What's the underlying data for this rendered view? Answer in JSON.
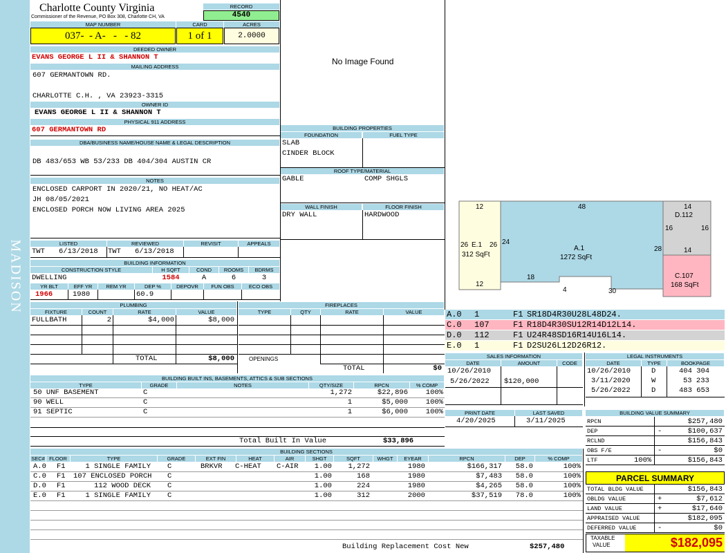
{
  "side_label": "MADISON",
  "county": {
    "name": "Charlotte County Virginia",
    "sub": "Commissioner of the Revenue, PO Box 308, Charlotte CH, VA"
  },
  "record": {
    "label": "RECORD",
    "value": "4540"
  },
  "map": {
    "label": "MAP NUMBER",
    "value": "037-  - A-   -   - 82"
  },
  "card": {
    "label": "CARD",
    "value": "1 of 1"
  },
  "acres": {
    "label": "ACRES",
    "value": "2.0000"
  },
  "owner": {
    "label": "DEEDED OWNER",
    "value": "EVANS GEORGE L II & SHANNON T"
  },
  "mailing": {
    "label": "MAILING ADDRESS",
    "line1": "607 GERMANTOWN RD.",
    "line2": "CHARLOTTE C.H. , VA 23923-3315"
  },
  "owner_id": {
    "label": "OWNER ID",
    "value": "EVANS GEORGE L II & SHANNON T"
  },
  "physical": {
    "label": "PHYSICAL 911 ADDRESS",
    "value": "607 GERMANTOWN RD"
  },
  "legal_desc": {
    "label": "DBA/BUSINESS NAME/HOUSE NAME & LEGAL DESCRIPTION",
    "value": "DB 483/653 WB 53/233 DB 404/304 AUSTIN CR"
  },
  "notes": {
    "label": "NOTES",
    "lines": [
      "ENCLOSED CARPORT IN 2020/21, NO HEAT/AC",
      "JH 08/05/2021",
      "ENCLOSED PORCH NOW LIVING AREA 2025"
    ]
  },
  "listed": {
    "label": "LISTED",
    "by": "TWT",
    "date": "6/13/2018"
  },
  "reviewed": {
    "label": "REVIEWED",
    "by": "TWT",
    "date": "6/13/2018"
  },
  "revisit": {
    "label": "REVISIT"
  },
  "appeals": {
    "label": "APPEALS"
  },
  "image_placeholder": "No Image Found",
  "building_props": {
    "label": "BUILDING PROPERTIES",
    "foundation_label": "FOUNDATION",
    "fuel_label": "FUEL TYPE",
    "foundation": [
      "SLAB",
      "CINDER BLOCK"
    ],
    "roof_label": "ROOF TYPE/MATERIAL",
    "roof_type": "GABLE",
    "roof_material": "COMP SHGLS",
    "wall_label": "WALL FINISH",
    "floor_label": "FLOOR FINISH",
    "wall": "DRY WALL",
    "floor": "HARDWOOD"
  },
  "building_info": {
    "label": "BUILDING INFORMATION",
    "h_style": "CONSTRUCTION STYLE",
    "h_hsqft": "H SQFT",
    "h_cond": "COND",
    "h_rooms": "ROOMS",
    "h_bdrms": "BDRMS",
    "style": "DWELLING",
    "hsqft": "1584",
    "cond": "A",
    "rooms": "6",
    "bdrms": "3",
    "h_yrblt": "YR BLT",
    "h_effyr": "EFF YR",
    "h_remyr": "REM YR",
    "h_dep": "DEP %",
    "h_depovr": "DEPOVR",
    "h_funobs": "FUN OBS",
    "h_ecoobs": "ECO OBS",
    "yrblt": "1966",
    "effyr": "1980",
    "dep": "60.9"
  },
  "plumbing": {
    "label": "PLUMBING",
    "headers": [
      "FIXTURE",
      "COUNT",
      "RATE",
      "VALUE"
    ],
    "rows": [
      {
        "fixture": "FULLBATH",
        "count": "2",
        "rate": "$4,000",
        "value": "$8,000"
      }
    ],
    "total_label": "TOTAL",
    "total": "$8,000"
  },
  "fireplaces": {
    "label": "FIREPLACES",
    "headers": [
      "TYPE",
      "QTY",
      "RATE",
      "VALUE"
    ],
    "openings_label": "OPENINGS",
    "total_label": "TOTAL",
    "total": "$0"
  },
  "builtins": {
    "label": "BUILDING BUILT INS, BASEMENTS, ATTICS & SUB SECTIONS",
    "headers": [
      "TYPE",
      "GRADE",
      "NOTES",
      "QTY/SIZE",
      "RPCN",
      "% COMP"
    ],
    "rows": [
      {
        "type": "50 UNF BASEMENT",
        "grade": "C",
        "qty": "1,272",
        "rpcn": "$22,896",
        "comp": "100%"
      },
      {
        "type": "90 WELL",
        "grade": "C",
        "qty": "1",
        "rpcn": "$5,000",
        "comp": "100%"
      },
      {
        "type": "91 SEPTIC",
        "grade": "C",
        "qty": "1",
        "rpcn": "$6,000",
        "comp": "100%"
      }
    ],
    "total_label": "Total Built In Value",
    "total": "$33,896"
  },
  "sections": {
    "label": "BUILDING SECTIONS",
    "headers": [
      "SEC#",
      "FLOOR",
      "TYPE",
      "GRADE",
      "EXT FIN",
      "HEAT",
      "AIR",
      "SHGT",
      "SQFT",
      "WHGT",
      "EYEAR",
      "RPCN",
      "DEP",
      "% COMP"
    ],
    "rows": [
      {
        "sec": "A.0",
        "floor": "F1",
        "type": "1 SINGLE FAMILY",
        "grade": "C",
        "extfin": "BRKVR",
        "heat": "C-HEAT",
        "air": "C-AIR",
        "shgt": "1.00",
        "sqft": "1,272",
        "eyear": "1980",
        "rpcn": "$166,317",
        "dep": "58.0",
        "comp": "100%"
      },
      {
        "sec": "C.0",
        "floor": "F1",
        "type": "107 ENCLOSED PORCH",
        "grade": "C",
        "extfin": "",
        "heat": "",
        "air": "",
        "shgt": "1.00",
        "sqft": "168",
        "eyear": "1980",
        "rpcn": "$7,483",
        "dep": "58.0",
        "comp": "100%"
      },
      {
        "sec": "D.0",
        "floor": "F1",
        "type": "112 WOOD DECK",
        "grade": "C",
        "extfin": "",
        "heat": "",
        "air": "",
        "shgt": "1.00",
        "sqft": "224",
        "eyear": "1980",
        "rpcn": "$4,265",
        "dep": "58.0",
        "comp": "100%"
      },
      {
        "sec": "E.0",
        "floor": "F1",
        "type": "1 SINGLE FAMILY",
        "grade": "C",
        "extfin": "",
        "heat": "",
        "air": "",
        "shgt": "1.00",
        "sqft": "312",
        "eyear": "2000",
        "rpcn": "$37,519",
        "dep": "78.0",
        "comp": "100%"
      }
    ],
    "total_label": "Building Replacement Cost New",
    "total": "$257,480"
  },
  "sketch": {
    "e_label": "E.1",
    "e_area": "312 SqFt",
    "a_label": "A.1",
    "a_area": "1272 SqFt",
    "d_label": "D.112",
    "c_label": "C.107",
    "c_area": "168 SqFt",
    "dims": {
      "e_top": "12",
      "e_left": "26",
      "e_right": "26",
      "e_bottom": "12",
      "a_top": "48",
      "a_left": "24",
      "a_right": "28",
      "a_b1": "18",
      "a_b2": "4",
      "a_b3": "30",
      "d_top": "14",
      "d_left": "16",
      "d_right": "16",
      "d_bottom": "14"
    },
    "colors": {
      "a": "#add8e6",
      "c": "#ffb6c1",
      "d": "#d3d3d3",
      "e": "#fffde0"
    }
  },
  "sketch_legend": [
    {
      "sec": "A.0",
      "n": "1",
      "f": "F1",
      "code": "SR18D4R30U28L48D24.",
      "color": "#add8e6"
    },
    {
      "sec": "C.0",
      "n": "107",
      "f": "F1",
      "code": "R18D4R30SU12R14D12L14.",
      "color": "#ffb6c1"
    },
    {
      "sec": "D.0",
      "n": "112",
      "f": "F1",
      "code": "U24R48SD16R14U16L14.",
      "color": "#d3d3d3"
    },
    {
      "sec": "E.0",
      "n": "1",
      "f": "F1",
      "code": "D2SU26L12D26R12.",
      "color": "#fffde0"
    }
  ],
  "sales": {
    "label": "SALES INFORMATION",
    "headers": [
      "DATE",
      "AMOUNT",
      "CODE"
    ],
    "rows": [
      {
        "date": "10/26/2010",
        "amount": "",
        "code": ""
      },
      {
        "date": "5/26/2022",
        "amount": "$120,000",
        "code": ""
      }
    ]
  },
  "legal": {
    "label": "LEGAL INSTRUMENTS",
    "headers": [
      "DATE",
      "TYPE",
      "BOOKPAGE"
    ],
    "rows": [
      {
        "date": "10/26/2010",
        "type": "D",
        "book": "404 304"
      },
      {
        "date": "3/11/2020",
        "type": "W",
        "book": "53 233"
      },
      {
        "date": "5/26/2022",
        "type": "D",
        "book": "483 653"
      }
    ]
  },
  "print_date": {
    "label": "PRINT DATE",
    "value": "4/20/2025"
  },
  "last_saved": {
    "label": "LAST SAVED",
    "value": "3/11/2025"
  },
  "bvs": {
    "label": "BUILDING VALUE SUMMARY",
    "rows": [
      {
        "k": "RPCN",
        "sign": "",
        "v": "$257,480"
      },
      {
        "k": "DEP",
        "sign": "-",
        "v": "$100,637"
      },
      {
        "k": "RCLND",
        "sign": "",
        "v": "$156,843"
      },
      {
        "k": "OBS F/E",
        "sign": "-",
        "v": "$0"
      },
      {
        "k": "LTF",
        "pct": "100%",
        "sign": "",
        "v": "$156,843"
      }
    ]
  },
  "parcel": {
    "label": "PARCEL SUMMARY",
    "rows": [
      {
        "k": "TOTAL BLDG VALUE",
        "sign": "",
        "v": "$156,843"
      },
      {
        "k": "OBLDG VALUE",
        "sign": "+",
        "v": "$7,612"
      },
      {
        "k": "LAND VALUE",
        "sign": "+",
        "v": "$17,640"
      },
      {
        "k": "APPRAISED VALUE",
        "sign": "",
        "v": "$182,095"
      },
      {
        "k": "DEFERRED VALUE",
        "sign": "-",
        "v": "$0"
      }
    ],
    "taxable_label1": "TAXABLE",
    "taxable_label2": "VALUE",
    "taxable": "$182,095"
  }
}
